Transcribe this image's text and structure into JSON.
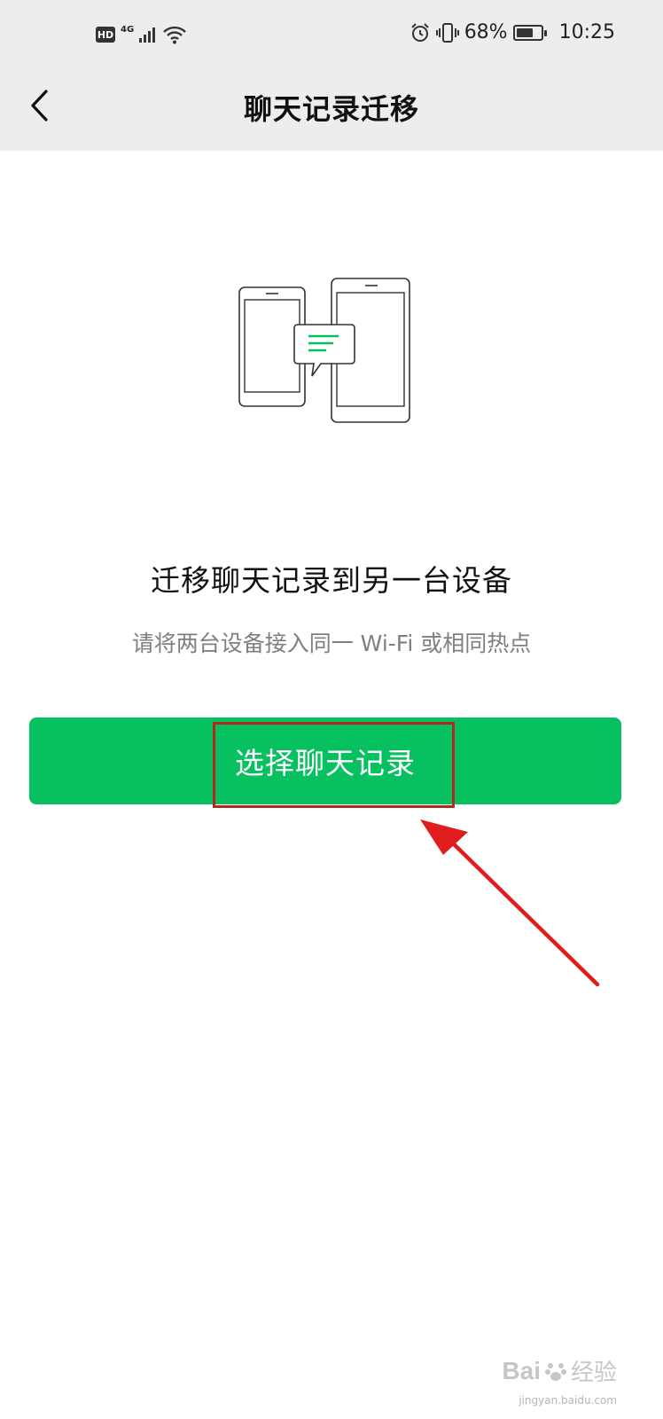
{
  "status_bar": {
    "hd_label": "HD",
    "network_label": "4G",
    "battery_percent": "68%",
    "battery_level": 0.68,
    "time": "10:25"
  },
  "nav": {
    "title": "聊天记录迁移"
  },
  "content": {
    "headline": "迁移聊天记录到另一台设备",
    "instruction": "请将两台设备接入同一 Wi-Fi 或相同热点"
  },
  "action": {
    "select_button_label": "选择聊天记录"
  },
  "watermark": {
    "logo_text": "Bai",
    "logo_suffix": "经验",
    "url": "jingyan.baidu.com"
  },
  "colors": {
    "accent_green": "#07c160",
    "annotation_red": "#e01d1d",
    "nav_background": "#ededed"
  }
}
